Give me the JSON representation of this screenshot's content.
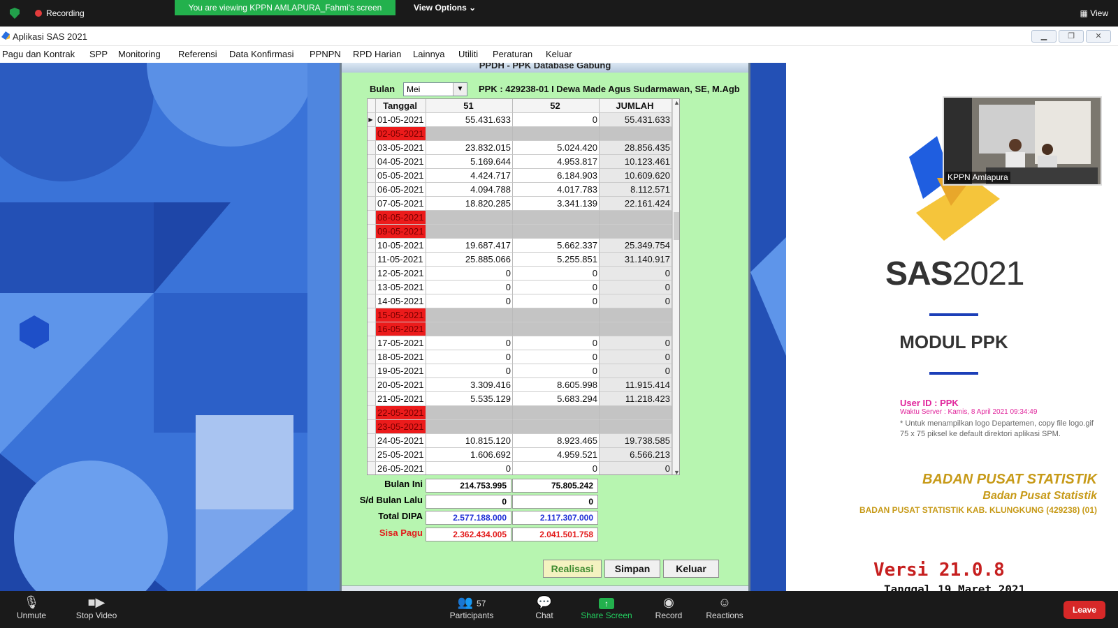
{
  "zoom": {
    "recording": "Recording",
    "viewing_banner": "You are viewing KPPN AMLAPURA_Fahmi's screen",
    "view_options": "View Options ⌄",
    "view": "View",
    "video_name": "KPPN Amlapura",
    "bottom": {
      "unmute": "Unmute",
      "stop_video": "Stop Video",
      "participants": "Participants",
      "participants_count": "57",
      "chat": "Chat",
      "share_screen": "Share Screen",
      "record": "Record",
      "reactions": "Reactions",
      "leave": "Leave"
    }
  },
  "app": {
    "title": "Aplikasi SAS 2021",
    "menu": [
      "Pagu dan Kontrak",
      "SPP",
      "Monitoring",
      "Referensi",
      "Data Konfirmasi",
      "PPNPN",
      "RPD Harian",
      "Lainnya",
      "Utiliti",
      "Peraturan",
      "Keluar"
    ]
  },
  "dialog": {
    "title": "PPDH - PPK Database Gabung",
    "bulan_label": "Bulan",
    "bulan_value": "Mei",
    "ppk": "PPK : 429238-01 I Dewa Made Agus Sudarmawan, SE, M.Agb",
    "columns": [
      "Tanggal",
      "51",
      "52",
      "JUMLAH"
    ],
    "rows": [
      {
        "d": "01-05-2021",
        "a": "55.431.633",
        "b": "0",
        "j": "55.431.633",
        "w": false
      },
      {
        "d": "02-05-2021",
        "a": "",
        "b": "",
        "j": "",
        "w": true
      },
      {
        "d": "03-05-2021",
        "a": "23.832.015",
        "b": "5.024.420",
        "j": "28.856.435",
        "w": false
      },
      {
        "d": "04-05-2021",
        "a": "5.169.644",
        "b": "4.953.817",
        "j": "10.123.461",
        "w": false
      },
      {
        "d": "05-05-2021",
        "a": "4.424.717",
        "b": "6.184.903",
        "j": "10.609.620",
        "w": false
      },
      {
        "d": "06-05-2021",
        "a": "4.094.788",
        "b": "4.017.783",
        "j": "8.112.571",
        "w": false
      },
      {
        "d": "07-05-2021",
        "a": "18.820.285",
        "b": "3.341.139",
        "j": "22.161.424",
        "w": false
      },
      {
        "d": "08-05-2021",
        "a": "",
        "b": "",
        "j": "",
        "w": true
      },
      {
        "d": "09-05-2021",
        "a": "",
        "b": "",
        "j": "",
        "w": true
      },
      {
        "d": "10-05-2021",
        "a": "19.687.417",
        "b": "5.662.337",
        "j": "25.349.754",
        "w": false
      },
      {
        "d": "11-05-2021",
        "a": "25.885.066",
        "b": "5.255.851",
        "j": "31.140.917",
        "w": false
      },
      {
        "d": "12-05-2021",
        "a": "0",
        "b": "0",
        "j": "0",
        "w": false
      },
      {
        "d": "13-05-2021",
        "a": "0",
        "b": "0",
        "j": "0",
        "w": false
      },
      {
        "d": "14-05-2021",
        "a": "0",
        "b": "0",
        "j": "0",
        "w": false
      },
      {
        "d": "15-05-2021",
        "a": "",
        "b": "",
        "j": "",
        "w": true
      },
      {
        "d": "16-05-2021",
        "a": "",
        "b": "",
        "j": "",
        "w": true
      },
      {
        "d": "17-05-2021",
        "a": "0",
        "b": "0",
        "j": "0",
        "w": false
      },
      {
        "d": "18-05-2021",
        "a": "0",
        "b": "0",
        "j": "0",
        "w": false
      },
      {
        "d": "19-05-2021",
        "a": "0",
        "b": "0",
        "j": "0",
        "w": false
      },
      {
        "d": "20-05-2021",
        "a": "3.309.416",
        "b": "8.605.998",
        "j": "11.915.414",
        "w": false
      },
      {
        "d": "21-05-2021",
        "a": "5.535.129",
        "b": "5.683.294",
        "j": "11.218.423",
        "w": false
      },
      {
        "d": "22-05-2021",
        "a": "",
        "b": "",
        "j": "",
        "w": true
      },
      {
        "d": "23-05-2021",
        "a": "",
        "b": "",
        "j": "",
        "w": true
      },
      {
        "d": "24-05-2021",
        "a": "10.815.120",
        "b": "8.923.465",
        "j": "19.738.585",
        "w": false
      },
      {
        "d": "25-05-2021",
        "a": "1.606.692",
        "b": "4.959.521",
        "j": "6.566.213",
        "w": false
      },
      {
        "d": "26-05-2021",
        "a": "0",
        "b": "0",
        "j": "0",
        "w": false
      }
    ],
    "summary": {
      "bulan_ini_label": "Bulan Ini",
      "bulan_ini_51": "214.753.995",
      "bulan_ini_52": "75.805.242",
      "sd_label": "S/d Bulan Lalu",
      "sd_51": "0",
      "sd_52": "0",
      "dipa_label": "Total DIPA",
      "dipa_51": "2.577.188.000",
      "dipa_52": "2.117.307.000",
      "sisa_label": "Sisa Pagu",
      "sisa_51": "2.362.434.005",
      "sisa_52": "2.041.501.758"
    },
    "buttons": {
      "realisasi": "Realisasi",
      "simpan": "Simpan",
      "keluar": "Keluar"
    }
  },
  "splash": {
    "logo_sas": "SAS",
    "logo_year": "2021",
    "modul": "MODUL PPK",
    "user_id": "User ID : PPK",
    "waktu": "Waktu Server : Kamis, 8 April 2021 09:34:49",
    "note": "* Untuk menampilkan logo Departemen, copy file logo.gif 75 x 75 piksel ke default direktori aplikasi SPM.",
    "org1": "BADAN PUSAT STATISTIK",
    "org2": "Badan Pusat Statistik",
    "org3": "BADAN PUSAT STATISTIK KAB. KLUNGKUNG (429238) (01)",
    "versi": "Versi 21.0.8",
    "tanggal": "Tanggal 19 Maret 2021"
  },
  "colors": {
    "weekend_red": "#ec1b1b",
    "dialog_green": "#b7f5b0",
    "bg_blue": "#3a73d8",
    "dipa_blue": "#1f2fd6",
    "sisa_red": "#e21b1b",
    "accent_blue": "#1c3fb8"
  }
}
